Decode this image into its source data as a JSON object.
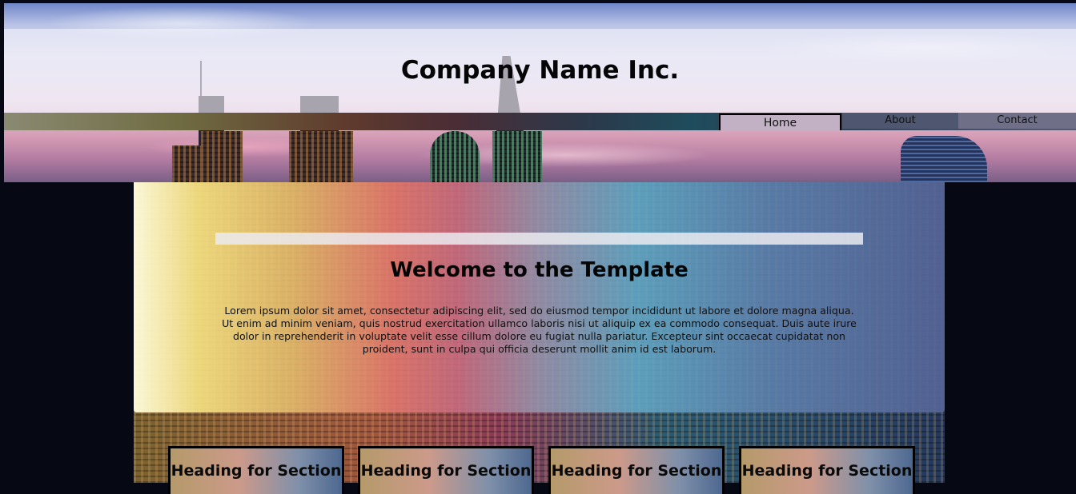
{
  "header": {
    "company_name": "Company Name Inc."
  },
  "nav": {
    "items": [
      {
        "label": "Home",
        "active": true
      },
      {
        "label": "About",
        "active": false
      },
      {
        "label": "Contact",
        "active": false
      }
    ]
  },
  "hero": {
    "title": "Welcome to the Template",
    "body": "Lorem ipsum dolor sit amet, consectetur adipiscing elit, sed do eiusmod tempor incididunt ut labore et dolore magna aliqua. Ut enim ad minim veniam, quis nostrud exercitation ullamco laboris nisi ut aliquip ex ea commodo consequat. Duis aute irure dolor in reprehenderit in voluptate velit esse cillum dolore eu fugiat nulla pariatur. Excepteur sint occaecat cupidatat non proident, sunt in culpa qui officia deserunt mollit anim id est laborum."
  },
  "sections": [
    {
      "heading": "Heading for Section"
    },
    {
      "heading": "Heading for Section"
    },
    {
      "heading": "Heading for Section"
    },
    {
      "heading": "Heading for Section"
    }
  ],
  "colors": {
    "page_background": "#060813",
    "nav_active": "#c2b0c4",
    "text": "#050505"
  }
}
